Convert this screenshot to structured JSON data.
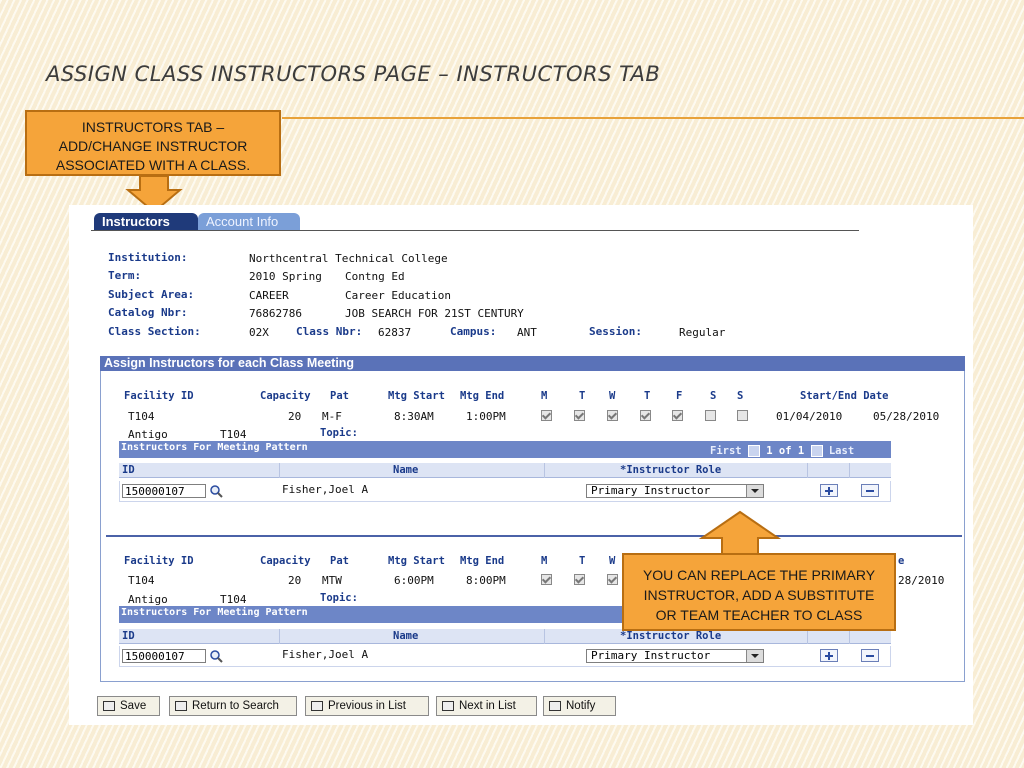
{
  "slide": {
    "title": "ASSIGN CLASS INSTRUCTORS PAGE – INSTRUCTORS TAB",
    "callout_top": [
      "INSTRUCTORS TAB –",
      "ADD/CHANGE INSTRUCTOR",
      "ASSOCIATED WITH A CLASS."
    ],
    "callout_bottom": [
      "YOU CAN REPLACE THE PRIMARY",
      "INSTRUCTOR, ADD A SUBSTITUTE",
      "OR TEAM TEACHER TO CLASS"
    ],
    "accent_color": "#f5a43a"
  },
  "tabs": [
    {
      "label": "Instructors",
      "active": true
    },
    {
      "label": "Account Info",
      "active": false
    }
  ],
  "header": {
    "institution_label": "Institution:",
    "institution": "Northcentral Technical College",
    "term_label": "Term:",
    "term_code": "2010 Spring",
    "term_desc": "Contng Ed",
    "subject_label": "Subject Area:",
    "subject_code": "CAREER",
    "subject_desc": "Career Education",
    "catalog_label": "Catalog Nbr:",
    "catalog_nbr": "76862786",
    "catalog_desc": "JOB SEARCH FOR 21ST CENTURY",
    "section_label": "Class Section:",
    "section": "02X",
    "classnbr_label": "Class Nbr:",
    "class_nbr": "62837",
    "campus_label": "Campus:",
    "campus": "ANT",
    "session_label": "Session:",
    "session": "Regular"
  },
  "assign_section_title": "Assign Instructors for each Class Meeting",
  "columns": {
    "facility_id": "Facility ID",
    "capacity": "Capacity",
    "pat": "Pat",
    "mtg_start": "Mtg Start",
    "mtg_end": "Mtg End",
    "days": [
      "M",
      "T",
      "W",
      "T",
      "F",
      "S",
      "S"
    ],
    "start_end_date": "Start/End Date",
    "topic_label": "Topic:"
  },
  "grid": {
    "title": "Instructors For Meeting Pattern",
    "first": "First",
    "page": "1 of 1",
    "last": "Last",
    "col_id": "ID",
    "col_name": "Name",
    "col_role": "*Instructor Role"
  },
  "meetings": [
    {
      "facility": "T104",
      "capacity": "20",
      "pat": "M-F",
      "start": "8:30AM",
      "end": "1:00PM",
      "days": [
        true,
        true,
        true,
        true,
        true,
        false,
        false
      ],
      "start_date": "01/04/2010",
      "end_date": "05/28/2010",
      "location": "Antigo",
      "room": "T104",
      "instructor": {
        "id": "150000107",
        "name": "Fisher,Joel A",
        "role": "Primary Instructor"
      }
    },
    {
      "facility": "T104",
      "capacity": "20",
      "pat": "MTW",
      "start": "6:00PM",
      "end": "8:00PM",
      "days": [
        true,
        true,
        true
      ],
      "date_fragment": "e",
      "end_date_fragment": "28/2010",
      "location": "Antigo",
      "room": "T104",
      "instructor": {
        "id": "150000107",
        "name": "Fisher,Joel A",
        "role": "Primary Instructor"
      }
    }
  ],
  "buttons": {
    "save": "Save",
    "return": "Return to Search",
    "previous": "Previous in List",
    "next": "Next in List",
    "notify": "Notify"
  }
}
